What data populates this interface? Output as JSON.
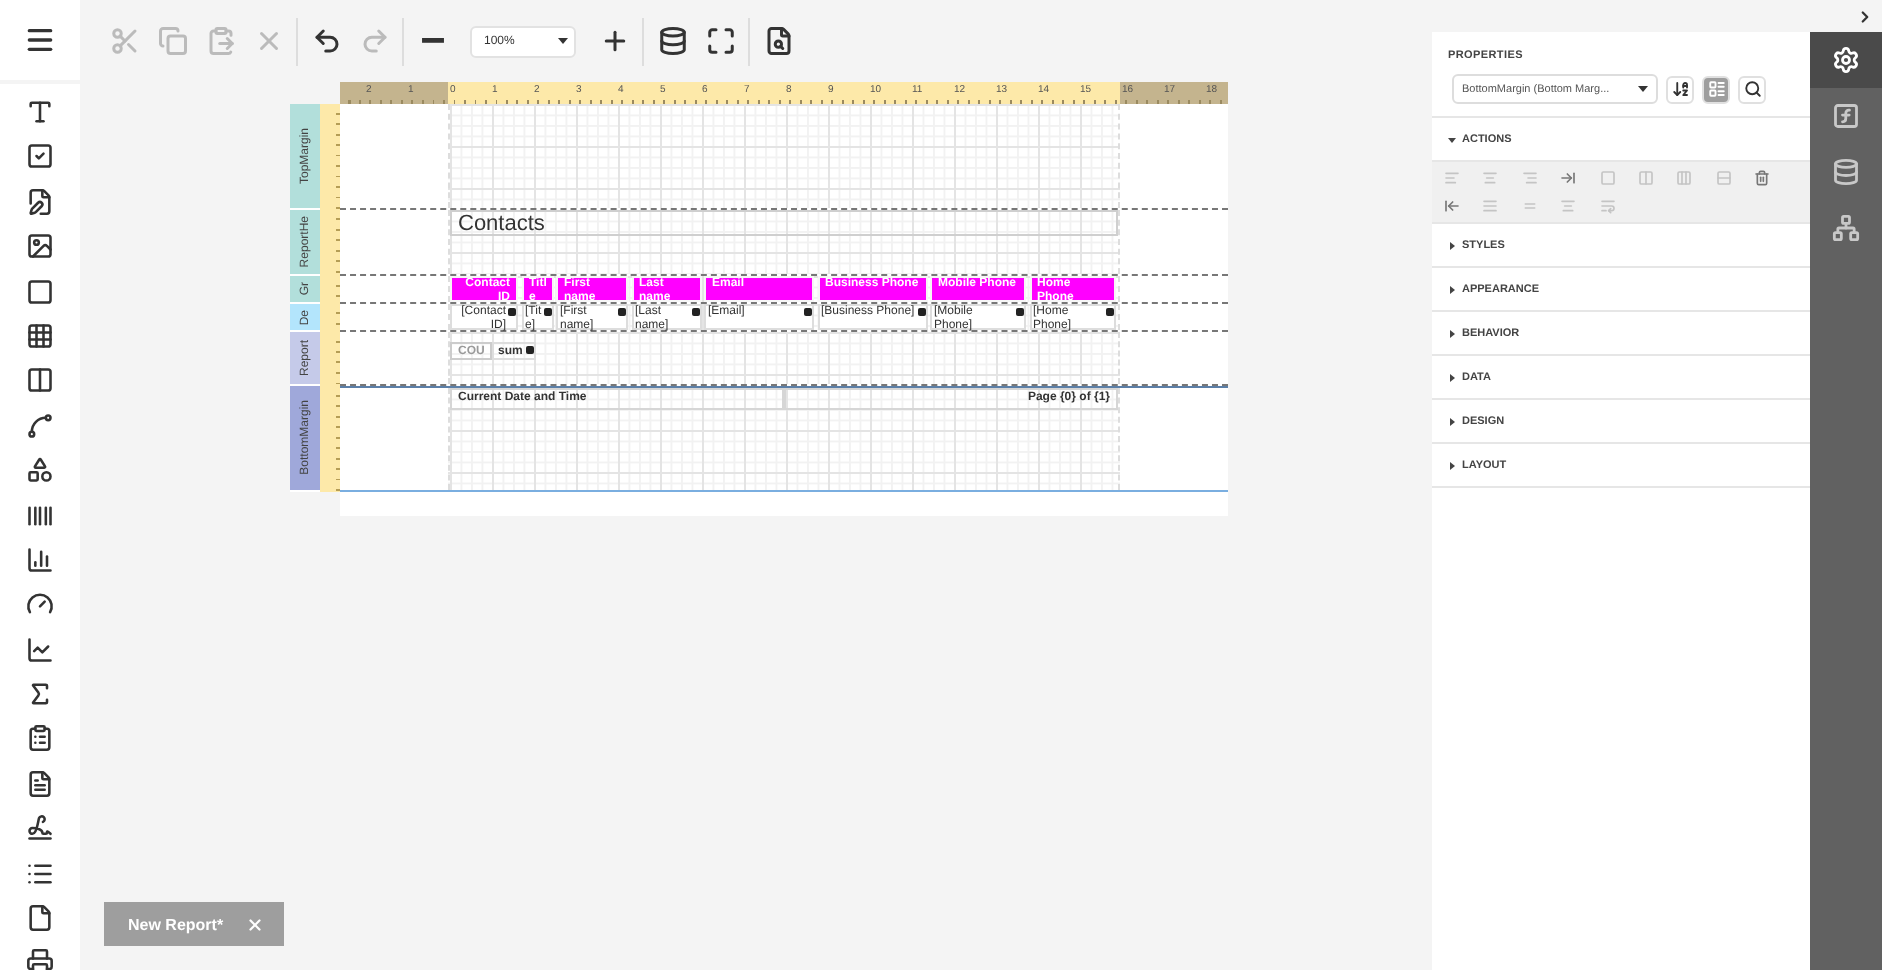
{
  "toolbar": {
    "groups": [
      [
        {
          "kind": "cut",
          "disabled": true
        },
        {
          "kind": "copy",
          "disabled": true
        },
        {
          "kind": "paste",
          "disabled": true
        },
        {
          "kind": "delete",
          "disabled": true
        }
      ],
      [
        {
          "kind": "undo",
          "disabled": false
        },
        {
          "kind": "redo",
          "disabled": true
        }
      ],
      [
        {
          "kind": "zoom_out",
          "disabled": false
        },
        {
          "kind": "zoom",
          "value": "100%"
        },
        {
          "kind": "zoom_in",
          "disabled": false
        }
      ],
      [
        {
          "kind": "data_source",
          "disabled": false
        },
        {
          "kind": "full_screen",
          "disabled": false
        }
      ],
      [
        {
          "kind": "preview",
          "disabled": false
        }
      ]
    ]
  },
  "ruler": {
    "labels": [
      "2",
      "1",
      "0",
      "1",
      "2",
      "3",
      "4",
      "5",
      "6",
      "7",
      "8",
      "9",
      "10",
      "11",
      "12",
      "13",
      "14",
      "15",
      "16",
      "17",
      "18"
    ]
  },
  "bands": [
    {
      "kind": "top_margin",
      "label": "TopMargin",
      "color": "#b2dfdb",
      "selected": false
    },
    {
      "kind": "report_header",
      "label": "ReportHe",
      "color": "#b2dfdb",
      "selected": false,
      "title": "Contacts"
    },
    {
      "kind": "group_header",
      "label": "Gr",
      "color": "#b2dfdb",
      "selected": false,
      "cells": [
        "Contact ID",
        "Titl e",
        "First name",
        "Last name",
        "Email",
        "Business Phone",
        "Mobile Phone",
        "Home Phone"
      ]
    },
    {
      "kind": "detail",
      "label": "De",
      "color": "#b3e5fc",
      "selected": false,
      "cells": [
        "[Contact ID]",
        "[Tit e]",
        "[First name]",
        "[Last name]",
        "[Email]",
        "[Business Phone]",
        "[Mobile Phone]",
        "[Home Phone]"
      ]
    },
    {
      "kind": "report_footer",
      "label": "Report",
      "color": "#c5cae9",
      "selected": false,
      "count": "COU",
      "sum": "sum"
    },
    {
      "kind": "bottom_margin",
      "label": "BottomMargin",
      "color": "#9fa8da",
      "selected": true,
      "left": "Current Date and Time",
      "right": "Page {0} of {1}"
    }
  ],
  "properties": {
    "title": "PROPERTIES",
    "selector": "BottomMargin (Bottom Marg...",
    "view_buttons": [
      {
        "kind": "sort",
        "selected": false
      },
      {
        "kind": "categories",
        "selected": true
      },
      {
        "kind": "search",
        "selected": false
      }
    ],
    "sections": [
      {
        "label": "ACTIONS",
        "expanded": true
      },
      {
        "label": "STYLES",
        "expanded": false
      },
      {
        "label": "APPEARANCE",
        "expanded": false
      },
      {
        "label": "BEHAVIOR",
        "expanded": false
      },
      {
        "label": "DATA",
        "expanded": false
      },
      {
        "label": "DESIGN",
        "expanded": false
      },
      {
        "label": "LAYOUT",
        "expanded": false
      }
    ]
  },
  "side_tabs": [
    {
      "kind": "properties",
      "selected": true
    },
    {
      "kind": "expressions",
      "selected": false
    },
    {
      "kind": "data",
      "selected": false
    },
    {
      "kind": "structure",
      "selected": false
    }
  ],
  "document_tabs": [
    {
      "label": "New Report*",
      "selected": true
    }
  ]
}
